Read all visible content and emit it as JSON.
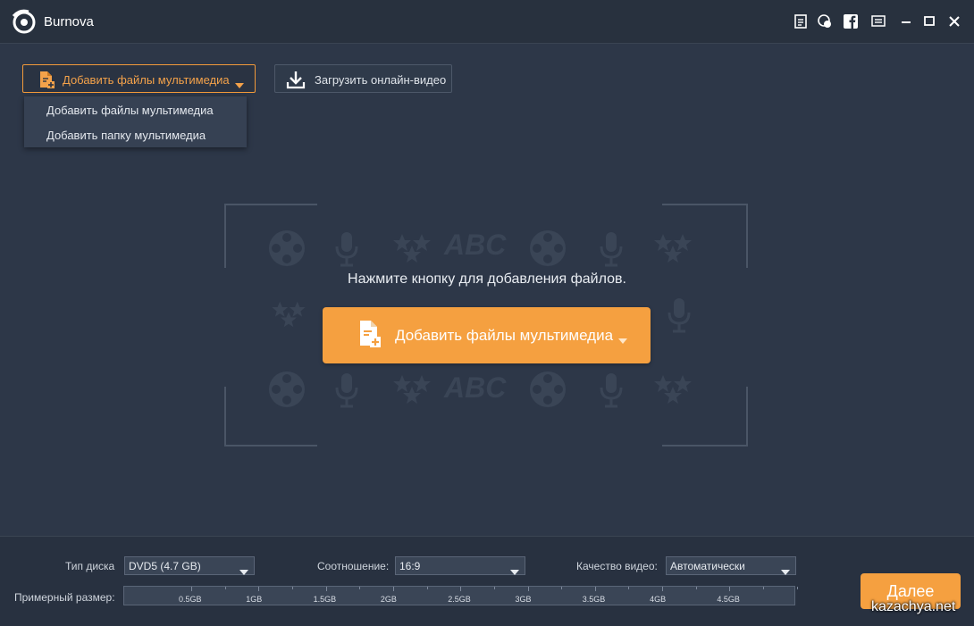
{
  "app": {
    "title": "Burnova"
  },
  "titlebar_icons": [
    "document-icon",
    "chat-icon",
    "facebook-icon",
    "menu-icon",
    "minimize-icon",
    "maximize-icon",
    "close-icon"
  ],
  "toolbar": {
    "add_media_label": "Добавить файлы мультимедиа",
    "download_label": "Загрузить онлайн-видео"
  },
  "dropdown": {
    "items": [
      {
        "label": "Добавить файлы мультимедиа"
      },
      {
        "label": "Добавить папку мультимедиа"
      }
    ]
  },
  "main": {
    "hint": "Нажмите кнопку для добавления файлов.",
    "big_add_label": "Добавить файлы мультимедиа",
    "watermark_text": "ABC"
  },
  "bottom": {
    "disc_type_label": "Тип диска",
    "disc_type_value": "DVD5 (4.7 GB)",
    "ratio_label": "Соотношение:",
    "ratio_value": "16:9",
    "quality_label": "Качество видео:",
    "quality_value": "Автоматически",
    "size_label": "Примерный размер:",
    "size_ticks": [
      "0.5GB",
      "1GB",
      "1.5GB",
      "2GB",
      "2.5GB",
      "3GB",
      "3.5GB",
      "4GB",
      "4.5GB"
    ],
    "next_label": "Далее"
  },
  "watermark_site": "kazachya.net",
  "colors": {
    "accent": "#f5a040",
    "background": "#2d3748",
    "titlebar": "#28313e"
  }
}
